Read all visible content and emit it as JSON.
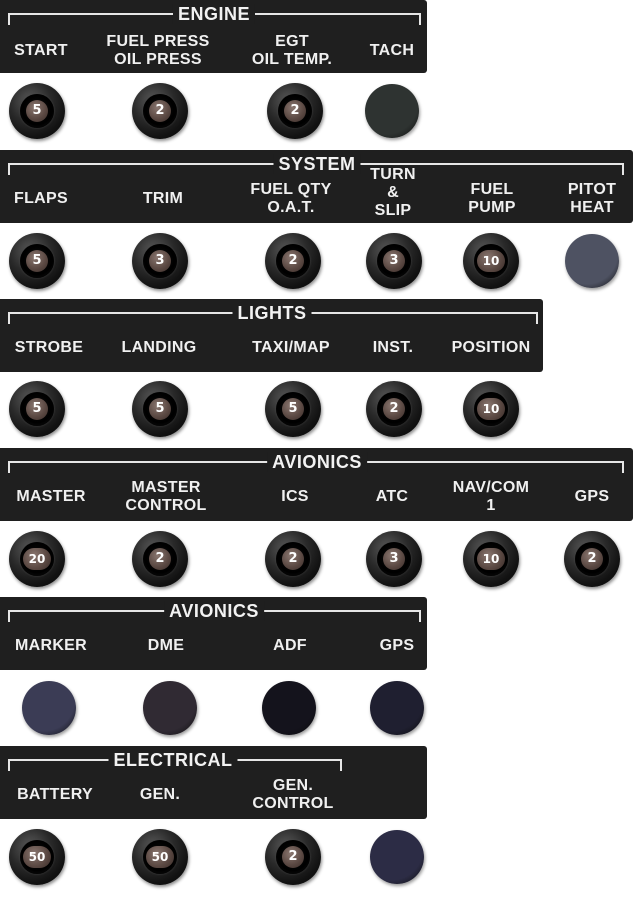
{
  "panels": {
    "engine": {
      "title": "ENGINE",
      "labels": [
        "START",
        "FUEL PRESS\nOIL PRESS",
        "EGT\nOIL TEMP.",
        "TACH"
      ],
      "controls": [
        "5",
        "2",
        "2"
      ],
      "switch_color": "#2e3331"
    },
    "system": {
      "title": "SYSTEM",
      "labels": [
        "FLAPS",
        "TRIM",
        "FUEL QTY\nO.A.T.",
        "TURN\n&\nSLIP",
        "FUEL\nPUMP",
        "PITOT\nHEAT"
      ],
      "controls": [
        "5",
        "3",
        "2",
        "3",
        "10"
      ],
      "switch_color": "#4e5262"
    },
    "lights": {
      "title": "LIGHTS",
      "labels": [
        "STROBE",
        "LANDING",
        "TAXI/MAP",
        "INST.",
        "POSITION"
      ],
      "controls": [
        "5",
        "5",
        "5",
        "2",
        "10"
      ]
    },
    "avionics1": {
      "title": "AVIONICS",
      "labels": [
        "MASTER",
        "MASTER\nCONTROL",
        "ICS",
        "ATC",
        "NAV/COM\n1",
        "GPS"
      ],
      "controls": [
        "20",
        "2",
        "2",
        "3",
        "10",
        "2"
      ]
    },
    "avionics2": {
      "title": "AVIONICS",
      "labels": [
        "MARKER",
        "DME",
        "ADF",
        "GPS"
      ],
      "switch_colors": [
        "#3b3c55",
        "#302a33",
        "#14131c",
        "#1f1f30"
      ]
    },
    "electrical": {
      "title": "ELECTRICAL",
      "labels": [
        "BATTERY",
        "GEN.",
        "GEN.\nCONTROL"
      ],
      "controls": [
        "50",
        "50",
        "2"
      ],
      "switch_color": "#2c2c45"
    }
  }
}
